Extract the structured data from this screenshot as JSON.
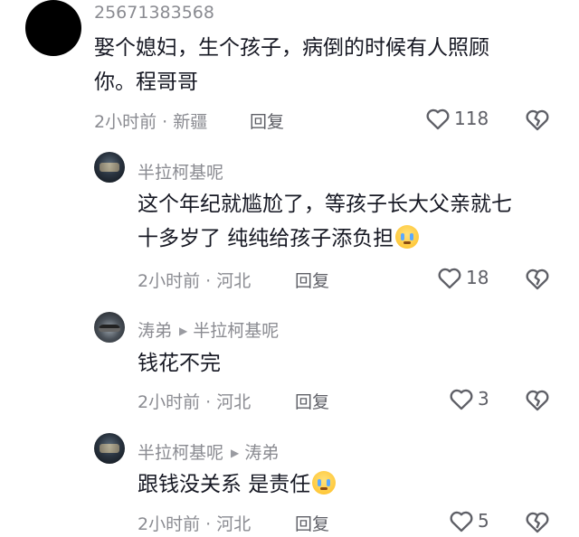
{
  "comments": [
    {
      "username": "25671383568",
      "text_line1": "娶个媳妇，生个孩子，病倒的时候有人照顾",
      "text_line2": "你。程哥哥",
      "meta": "2小时前 · 新疆",
      "reply_label": "回复",
      "likes": "118"
    },
    {
      "username": "半拉柯基呢",
      "text_line1": "这个年纪就尴尬了，等孩子长大父亲就七",
      "text_line2": "十多岁了 纯纯给孩子添负担",
      "emoji": "pleading-face",
      "meta": "2小时前 · 河北",
      "reply_label": "回复",
      "likes": "18"
    },
    {
      "username": "涛弟",
      "reply_to": "半拉柯基呢",
      "text_line1": "钱花不完",
      "meta": "2小时前 · 河北",
      "reply_label": "回复",
      "likes": "3"
    },
    {
      "username": "半拉柯基呢",
      "reply_to": "涛弟",
      "text_line1": "跟钱没关系 是责任",
      "emoji": "pleading-face",
      "meta": "2小时前 · 河北",
      "reply_label": "回复",
      "likes": "5"
    }
  ],
  "colors": {
    "primary_text": "#161823",
    "secondary_text": "#8a8b91",
    "icon": "#5e5f66"
  },
  "icons": {
    "like": "heart-outline-icon",
    "dislike": "broken-heart-icon",
    "reply_arrow": "triangle-right-icon"
  }
}
